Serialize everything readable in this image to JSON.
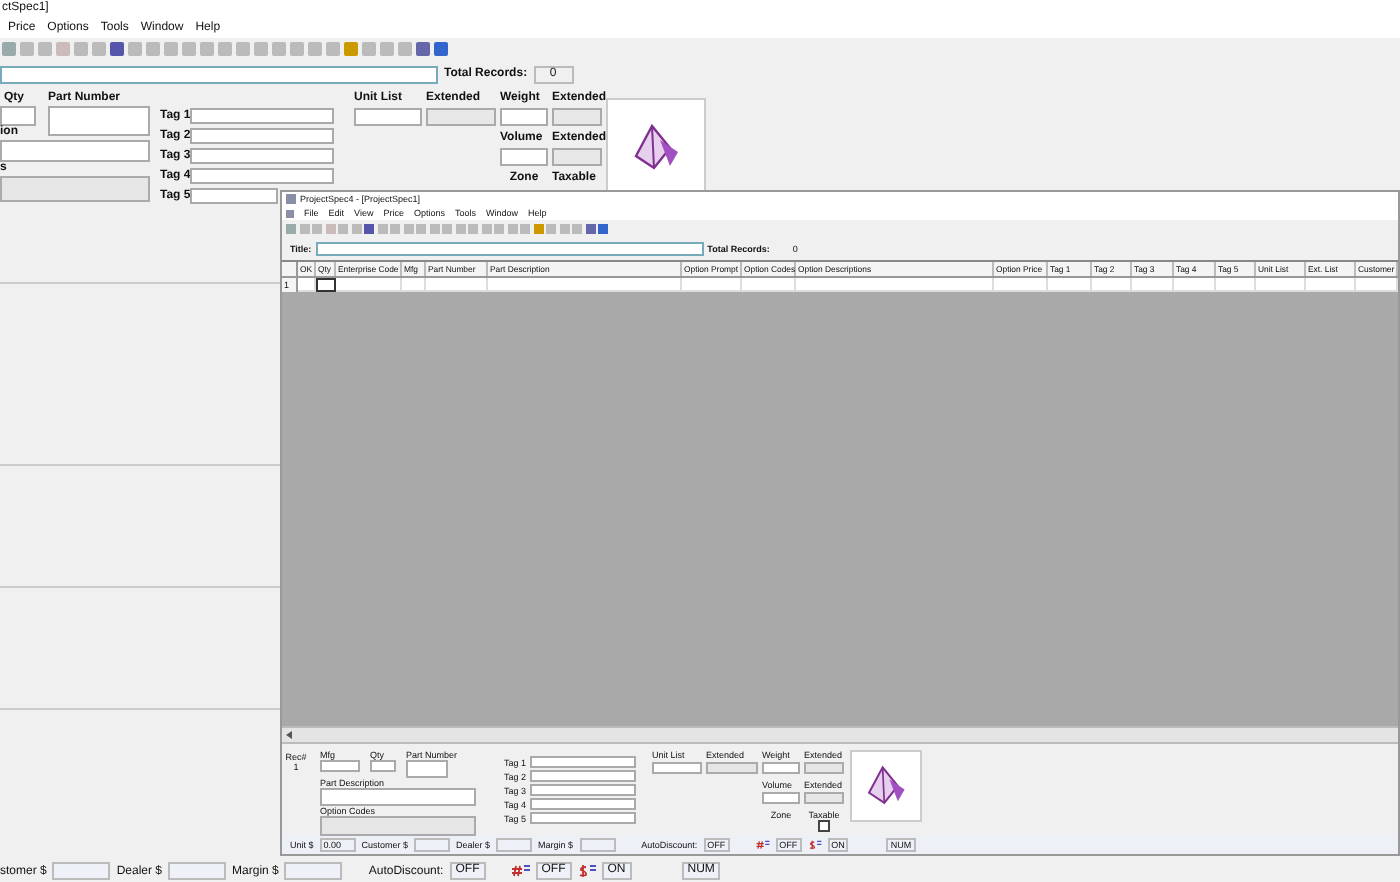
{
  "back_window": {
    "title": "ctSpec1]",
    "menu": [
      "Price",
      "Options",
      "Tools",
      "Window",
      "Help"
    ],
    "total_records": {
      "label": "Total Records:",
      "value": "0"
    },
    "form": {
      "qty_label": "Qty",
      "part_number_label": "Part Number",
      "description_label": "ion",
      "codes_label": "s",
      "tags": [
        "Tag 1",
        "Tag 2",
        "Tag 3",
        "Tag 4",
        "Tag 5"
      ],
      "unit_list_label": "Unit List",
      "extended_label": "Extended",
      "weight_label": "Weight",
      "weight_extended_label": "Extended",
      "volume_label": "Volume",
      "volume_extended_label": "Extended",
      "zone_label": "Zone",
      "taxable_label": "Taxable"
    },
    "status_bar": {
      "customer_label": "stomer $",
      "dealer_label": "Dealer $",
      "margin_label": "Margin $",
      "autodiscount_label": "AutoDiscount:",
      "autodiscount_value": "OFF",
      "hash_value": "OFF",
      "dollar_value": "ON",
      "num": "NUM"
    }
  },
  "front_window": {
    "title": "ProjectSpec4 - [ProjectSpec1]",
    "menu": [
      "File",
      "Edit",
      "View",
      "Price",
      "Options",
      "Tools",
      "Window",
      "Help"
    ],
    "title_label": "Title:",
    "total_records": {
      "label": "Total Records:",
      "value": "0"
    },
    "table": {
      "columns": [
        "OK",
        "Qty",
        "Enterprise Code",
        "Mfg",
        "Part Number",
        "Part Description",
        "Option Prompt",
        "Option Codes",
        "Option Descriptions",
        "Option Price",
        "Tag 1",
        "Tag 2",
        "Tag 3",
        "Tag 4",
        "Tag 5",
        "Unit List",
        "Ext. List",
        "Customer"
      ],
      "rows": [
        {
          "row_header": "1"
        }
      ]
    },
    "form": {
      "rec_label": "Rec#",
      "rec_value": "1",
      "mfg_label": "Mfg",
      "qty_label": "Qty",
      "part_number_label": "Part Number",
      "part_description_label": "Part Description",
      "option_codes_label": "Option Codes",
      "tags": [
        "Tag 1",
        "Tag 2",
        "Tag 3",
        "Tag 4",
        "Tag 5"
      ],
      "unit_list_label": "Unit List",
      "extended_label": "Extended",
      "weight_label": "Weight",
      "weight_extended_label": "Extended",
      "volume_label": "Volume",
      "volume_extended_label": "Extended",
      "zone_label": "Zone",
      "taxable_label": "Taxable",
      "taxable_checked": false
    },
    "status_bar": {
      "unit_label": "Unit $",
      "unit_value": "0.00",
      "customer_label": "Customer $",
      "dealer_label": "Dealer $",
      "margin_label": "Margin $",
      "autodiscount_label": "AutoDiscount:",
      "autodiscount_value": "OFF",
      "hash_value": "OFF",
      "dollar_value": "ON",
      "num": "NUM"
    }
  }
}
